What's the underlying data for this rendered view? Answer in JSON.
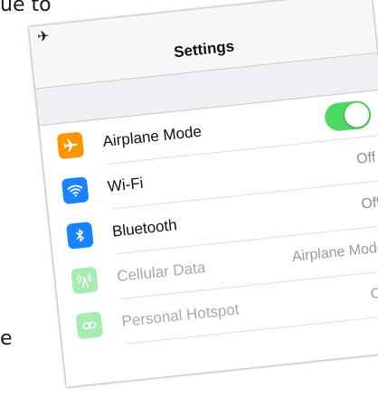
{
  "background_text": {
    "left_top": "ue to",
    "right_top": "t",
    "left_bottom": "e"
  },
  "status_bar": {
    "icon": "airplane-icon"
  },
  "nav": {
    "title": "Settings"
  },
  "rows": [
    {
      "label": "Airplane Mode",
      "icon": "airplane-icon",
      "icon_color": "#ff9500",
      "toggle_on": true
    },
    {
      "label": "Wi-Fi",
      "icon": "wifi-icon",
      "icon_color": "#1a82fb",
      "value": "Off"
    },
    {
      "label": "Bluetooth",
      "icon": "bluetooth-icon",
      "icon_color": "#1a82fb",
      "value": "Off"
    },
    {
      "label": "Cellular Data",
      "icon": "antenna-icon",
      "icon_color": "#4cd964",
      "value": "Airplane Mode",
      "disabled": true
    },
    {
      "label": "Personal Hotspot",
      "icon": "hotspot-icon",
      "icon_color": "#4cd964",
      "value": "Off",
      "disabled": true
    }
  ],
  "colors": {
    "toggle_on": "#4cd964",
    "accent_blue": "#1a82fb",
    "accent_orange": "#ff9500",
    "group_background": "#efeff4"
  }
}
